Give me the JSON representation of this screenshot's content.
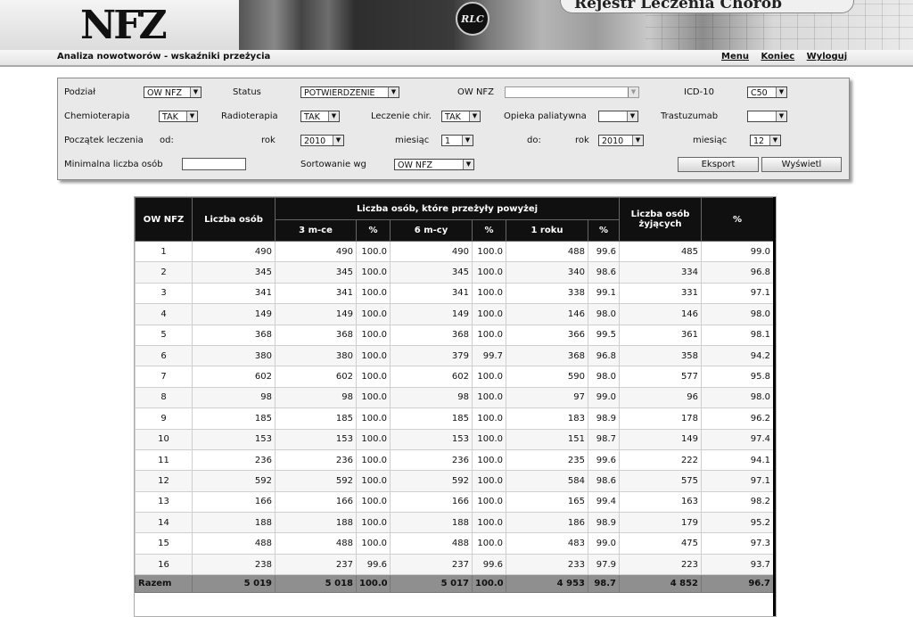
{
  "header": {
    "logo_text": "NFZ",
    "app_title": "Rejestr Leczenia Chorób",
    "badge": "RLC"
  },
  "titlebar": {
    "page_title": "Analiza nowotworów - wskaźniki przeżycia",
    "nav": [
      "Menu",
      "Koniec",
      "Wyloguj"
    ]
  },
  "filters": {
    "podzial_label": "Podział",
    "podzial_value": "OW NFZ",
    "status_label": "Status",
    "status_value": "POTWIERDZENIE",
    "ownfz_label": "OW NFZ",
    "ownfz_value": "",
    "icd_label": "ICD-10",
    "icd_value": "C50",
    "chemio_label": "Chemioterapia",
    "chemio_value": "TAK",
    "radio_label": "Radioterapia",
    "radio_value": "TAK",
    "chir_label": "Leczenie chir.",
    "chir_value": "TAK",
    "paliat_label": "Opieka paliatywna",
    "paliat_value": "",
    "trast_label": "Trastuzumab",
    "trast_value": "",
    "start_label": "Początek leczenia",
    "od_label": "od:",
    "rok_label": "rok",
    "rok_od_value": "2010",
    "miesiac_label": "miesiąc",
    "miesiac_od_value": "1",
    "do_label": "do:",
    "rok_do_value": "2010",
    "miesiac_do_value": "12",
    "minimal_label": "Minimalna liczba osób",
    "minimal_value": "",
    "sort_label": "Sortowanie wg",
    "sort_value": "OW NFZ",
    "export_button": "Eksport",
    "show_button": "Wyświetl"
  },
  "table": {
    "headers": {
      "ownfz": "OW NFZ",
      "count": "Liczba osób",
      "survived_group": "Liczba osób, które przeżyły powyżej",
      "m3": "3 m-ce",
      "pct": "%",
      "m6": "6 m-cy",
      "y1": "1 roku",
      "alive": "Liczba osób żyjących",
      "alive_pct": "%"
    },
    "rows": [
      [
        "1",
        "490",
        "490",
        "100.0",
        "490",
        "100.0",
        "488",
        "99.6",
        "485",
        "99.0"
      ],
      [
        "2",
        "345",
        "345",
        "100.0",
        "345",
        "100.0",
        "340",
        "98.6",
        "334",
        "96.8"
      ],
      [
        "3",
        "341",
        "341",
        "100.0",
        "341",
        "100.0",
        "338",
        "99.1",
        "331",
        "97.1"
      ],
      [
        "4",
        "149",
        "149",
        "100.0",
        "149",
        "100.0",
        "146",
        "98.0",
        "146",
        "98.0"
      ],
      [
        "5",
        "368",
        "368",
        "100.0",
        "368",
        "100.0",
        "366",
        "99.5",
        "361",
        "98.1"
      ],
      [
        "6",
        "380",
        "380",
        "100.0",
        "379",
        "99.7",
        "368",
        "96.8",
        "358",
        "94.2"
      ],
      [
        "7",
        "602",
        "602",
        "100.0",
        "602",
        "100.0",
        "590",
        "98.0",
        "577",
        "95.8"
      ],
      [
        "8",
        "98",
        "98",
        "100.0",
        "98",
        "100.0",
        "97",
        "99.0",
        "96",
        "98.0"
      ],
      [
        "9",
        "185",
        "185",
        "100.0",
        "185",
        "100.0",
        "183",
        "98.9",
        "178",
        "96.2"
      ],
      [
        "10",
        "153",
        "153",
        "100.0",
        "153",
        "100.0",
        "151",
        "98.7",
        "149",
        "97.4"
      ],
      [
        "11",
        "236",
        "236",
        "100.0",
        "236",
        "100.0",
        "235",
        "99.6",
        "222",
        "94.1"
      ],
      [
        "12",
        "592",
        "592",
        "100.0",
        "592",
        "100.0",
        "584",
        "98.6",
        "575",
        "97.1"
      ],
      [
        "13",
        "166",
        "166",
        "100.0",
        "166",
        "100.0",
        "165",
        "99.4",
        "163",
        "98.2"
      ],
      [
        "14",
        "188",
        "188",
        "100.0",
        "188",
        "100.0",
        "186",
        "98.9",
        "179",
        "95.2"
      ],
      [
        "15",
        "488",
        "488",
        "100.0",
        "488",
        "100.0",
        "483",
        "99.0",
        "475",
        "97.3"
      ],
      [
        "16",
        "238",
        "237",
        "99.6",
        "237",
        "99.6",
        "233",
        "97.9",
        "223",
        "93.7"
      ]
    ],
    "total": [
      "Razem",
      "5 019",
      "5 018",
      "100.0",
      "5 017",
      "100.0",
      "4 953",
      "98.7",
      "4 852",
      "96.7"
    ]
  }
}
